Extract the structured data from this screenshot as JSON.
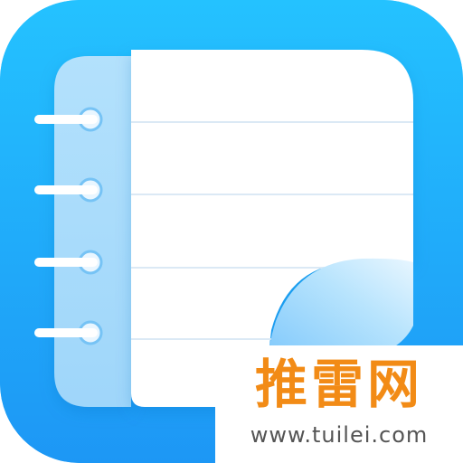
{
  "app_icon": {
    "icon_name": "notebook-icon",
    "colors": {
      "tile_top": "#22b8ff",
      "tile_bottom": "#1ea0f7",
      "paper": "#ffffff",
      "spine": "#a9dcfb",
      "line": "#d9eefb",
      "ring": "#ffffff",
      "page_curl": "#8fd0fb"
    }
  },
  "watermark": {
    "text_cn": "推雷网",
    "url": "www.tuilei.com",
    "text_color": "#f28b16",
    "url_color": "#555555"
  }
}
